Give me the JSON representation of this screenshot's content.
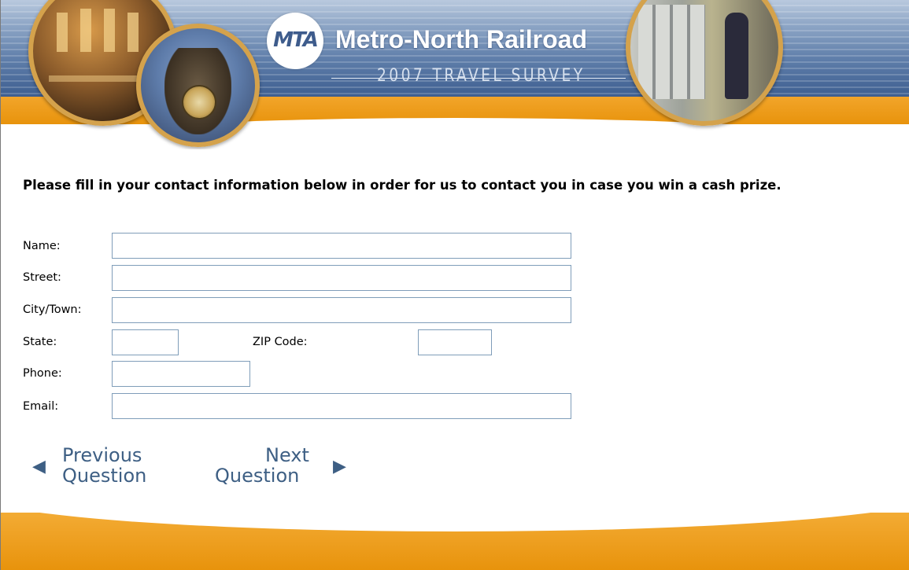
{
  "banner": {
    "logo_text": "MTA",
    "title": "Metro-North Railroad",
    "subtitle": "2007 TRAVEL SURVEY"
  },
  "intro": {
    "text": "Please fill in your contact information below in order for us to contact you in case you win a cash prize."
  },
  "form": {
    "name_label": "Name:",
    "street_label": "Street:",
    "city_label": "City/Town:",
    "state_label": "State:",
    "zip_label": "ZIP Code:",
    "phone_label": "Phone:",
    "email_label": "Email:",
    "name_value": "",
    "street_value": "",
    "city_value": "",
    "state_value": "",
    "zip_value": "",
    "phone_value": "",
    "email_value": ""
  },
  "nav": {
    "previous_line1": "Previous",
    "previous_line2": "Question",
    "next_line1": "Next",
    "next_line2": "Question",
    "previous_arrow": "◀",
    "next_arrow": "▶"
  },
  "colors": {
    "banner_blue": "#5f7eaa",
    "banner_orange": "#e8930c",
    "nav_text": "#3e5f84",
    "field_border": "#7f9db9"
  }
}
